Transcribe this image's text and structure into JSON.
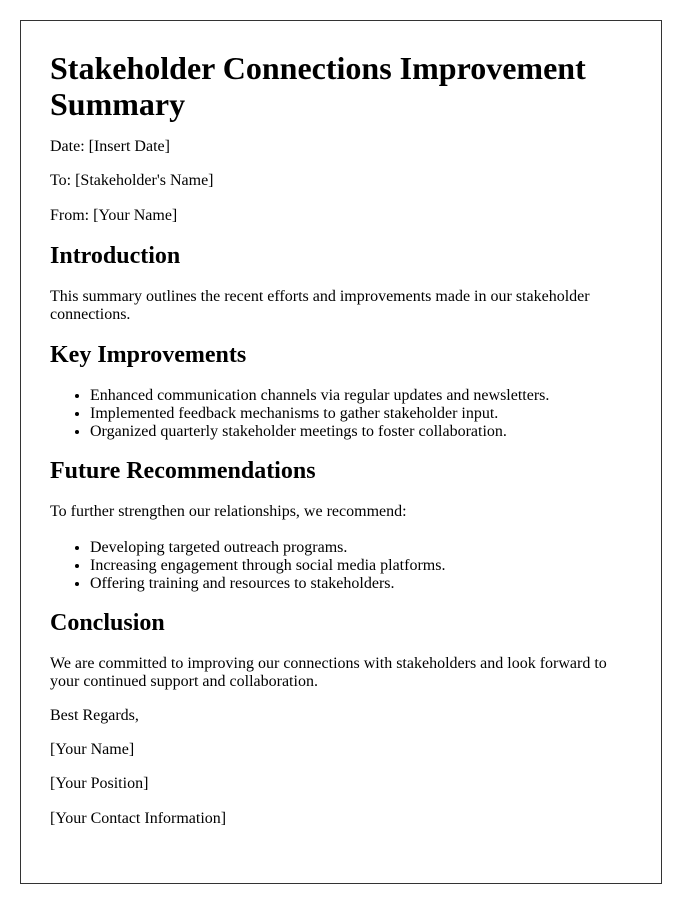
{
  "document": {
    "title": "Stakeholder Connections Improvement Summary",
    "meta": {
      "date": "Date: [Insert Date]",
      "to": "To: [Stakeholder's Name]",
      "from": "From: [Your Name]"
    },
    "introduction": {
      "heading": "Introduction",
      "text": "This summary outlines the recent efforts and improvements made in our stakeholder connections."
    },
    "key_improvements": {
      "heading": "Key Improvements",
      "items": [
        "Enhanced communication channels via regular updates and newsletters.",
        "Implemented feedback mechanisms to gather stakeholder input.",
        "Organized quarterly stakeholder meetings to foster collaboration."
      ]
    },
    "future_recommendations": {
      "heading": "Future Recommendations",
      "intro": "To further strengthen our relationships, we recommend:",
      "items": [
        "Developing targeted outreach programs.",
        "Increasing engagement through social media platforms.",
        "Offering training and resources to stakeholders."
      ]
    },
    "conclusion": {
      "heading": "Conclusion",
      "text": "We are committed to improving our connections with stakeholders and look forward to your continued support and collaboration."
    },
    "signature": {
      "closing": "Best Regards,",
      "name": "[Your Name]",
      "position": "[Your Position]",
      "contact": "[Your Contact Information]"
    }
  }
}
